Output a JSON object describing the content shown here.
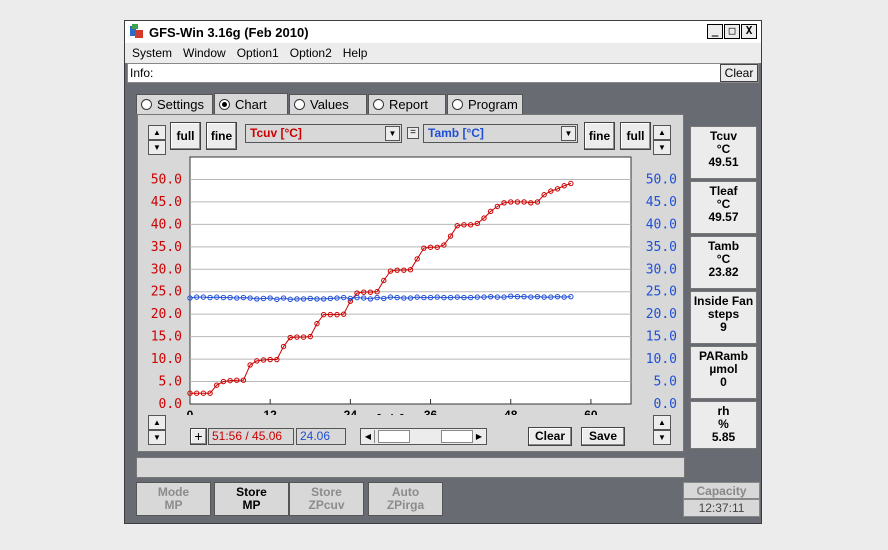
{
  "window": {
    "title": "GFS-Win 3.16g (Feb 2010)",
    "controls": [
      "_",
      "□",
      "X"
    ]
  },
  "menu": [
    "System",
    "Window",
    "Option1",
    "Option2",
    "Help"
  ],
  "info": {
    "label": "Info:",
    "clear_label": "Clear"
  },
  "tabs": [
    {
      "label": "Settings",
      "active": false
    },
    {
      "label": "Chart",
      "active": true
    },
    {
      "label": "Values",
      "active": false
    },
    {
      "label": "Report",
      "active": false
    },
    {
      "label": "Program",
      "active": false
    }
  ],
  "toolbar": {
    "full_left": "full",
    "fine_left": "fine",
    "series_left": "Tcuv [°C]",
    "equals": "=",
    "series_right": "Tamb [°C]",
    "fine_right": "fine",
    "full_right": "full"
  },
  "footer": {
    "plus": "+",
    "cursor_left": "51:56 / 45.06",
    "cursor_right": "24.06",
    "clear": "Clear",
    "save": "Save"
  },
  "sidebar": [
    {
      "name": "Tcuv",
      "unit": "°C",
      "value": "49.51"
    },
    {
      "name": "Tleaf",
      "unit": "°C",
      "value": "49.57"
    },
    {
      "name": "Tamb",
      "unit": "°C",
      "value": "23.82"
    },
    {
      "name": "Inside Fan",
      "unit": "steps",
      "value": "9"
    },
    {
      "name": "PARamb",
      "unit": "µmol",
      "value": "0"
    },
    {
      "name": "rh",
      "unit": "%",
      "value": "5.85"
    }
  ],
  "bottom_buttons": [
    {
      "line1": "Mode",
      "line2": "MP",
      "enabled": false
    },
    {
      "line1": "Store",
      "line2": "MP",
      "enabled": true
    },
    {
      "line1": "Store",
      "line2": "ZPcuv",
      "enabled": false
    },
    {
      "line1": "Auto",
      "line2": "ZPirga",
      "enabled": false
    }
  ],
  "capacity": {
    "label": "Capacity",
    "time": "12:37:11"
  },
  "colors": {
    "tcuv": "#cc0000",
    "tamb": "#1f4fd6",
    "panel": "#d8d8d8",
    "frame": "#686c72"
  },
  "chart_data": {
    "type": "line",
    "xlabel": "[min]",
    "xticks": [
      0,
      12,
      24,
      36,
      48,
      60
    ],
    "xlim": [
      0,
      66
    ],
    "ylim_left": [
      0,
      55
    ],
    "ylim_right": [
      0,
      55
    ],
    "yticks_left": [
      "0.0",
      "5.0",
      "10.0",
      "15.0",
      "20.0",
      "25.0",
      "30.0",
      "35.0",
      "40.0",
      "45.0",
      "50.0"
    ],
    "yticks_right": [
      "0.0",
      "5.0",
      "10.0",
      "15.0",
      "20.0",
      "25.0",
      "30.0",
      "35.0",
      "40.0",
      "45.0",
      "50.0"
    ],
    "grid": true,
    "series": [
      {
        "name": "Tcuv [°C]",
        "color": "#cc0000",
        "x": [
          0,
          1,
          2,
          3,
          4,
          5,
          6,
          7,
          8,
          9,
          10,
          11,
          12,
          13,
          14,
          15,
          16,
          17,
          18,
          19,
          20,
          21,
          22,
          23,
          24,
          25,
          26,
          27,
          28,
          29,
          30,
          31,
          32,
          33,
          34,
          35,
          36,
          37,
          38,
          39,
          40,
          41,
          42,
          43,
          44,
          45,
          46,
          47,
          48,
          49,
          50,
          51,
          52,
          53,
          54,
          55,
          56,
          57
        ],
        "y": [
          2.4,
          2.4,
          2.4,
          2.4,
          4.2,
          5.0,
          5.2,
          5.3,
          5.3,
          8.7,
          9.6,
          9.8,
          9.9,
          9.9,
          12.8,
          14.8,
          14.9,
          14.9,
          15.0,
          17.9,
          19.9,
          19.9,
          19.9,
          20.0,
          22.9,
          24.7,
          24.9,
          24.9,
          25.0,
          27.5,
          29.6,
          29.8,
          29.8,
          29.9,
          32.3,
          34.7,
          34.9,
          34.9,
          35.4,
          37.4,
          39.7,
          39.9,
          39.9,
          40.2,
          41.4,
          42.9,
          44.0,
          44.8,
          45.0,
          45.0,
          45.0,
          44.8,
          45.0,
          46.6,
          47.4,
          47.9,
          48.6,
          49.1
        ]
      },
      {
        "name": "Tamb [°C]",
        "color": "#1f4fd6",
        "x": [
          0,
          1,
          2,
          3,
          4,
          5,
          6,
          7,
          8,
          9,
          10,
          11,
          12,
          13,
          14,
          15,
          16,
          17,
          18,
          19,
          20,
          21,
          22,
          23,
          24,
          25,
          26,
          27,
          28,
          29,
          30,
          31,
          32,
          33,
          34,
          35,
          36,
          37,
          38,
          39,
          40,
          41,
          42,
          43,
          44,
          45,
          46,
          47,
          48,
          49,
          50,
          51,
          52,
          53,
          54,
          55,
          56,
          57
        ],
        "y": [
          23.6,
          23.8,
          23.8,
          23.7,
          23.8,
          23.7,
          23.7,
          23.6,
          23.7,
          23.6,
          23.4,
          23.5,
          23.6,
          23.3,
          23.6,
          23.3,
          23.4,
          23.4,
          23.5,
          23.4,
          23.4,
          23.5,
          23.6,
          23.7,
          23.5,
          23.7,
          23.6,
          23.4,
          23.7,
          23.5,
          23.8,
          23.7,
          23.6,
          23.6,
          23.8,
          23.7,
          23.7,
          23.8,
          23.7,
          23.7,
          23.8,
          23.7,
          23.7,
          23.8,
          23.8,
          23.9,
          23.8,
          23.8,
          24.0,
          23.9,
          23.9,
          23.8,
          23.9,
          23.8,
          23.8,
          23.9,
          23.8,
          23.9
        ]
      }
    ]
  }
}
